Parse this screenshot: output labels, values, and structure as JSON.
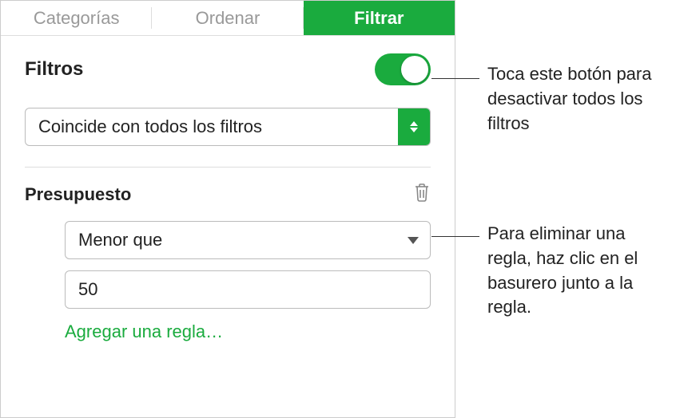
{
  "tabs": {
    "categories": "Categorías",
    "sort": "Ordenar",
    "filter": "Filtrar"
  },
  "heading": "Filtros",
  "matchSelect": "Coincide con todos los filtros",
  "rule": {
    "name": "Presupuesto",
    "operator": "Menor que",
    "value": "50"
  },
  "addRule": "Agregar una regla…",
  "callouts": {
    "toggle": "Toca este botón para desactivar todos los filtros",
    "trash": "Para eliminar una regla, haz clic en el basurero junto a la regla."
  }
}
